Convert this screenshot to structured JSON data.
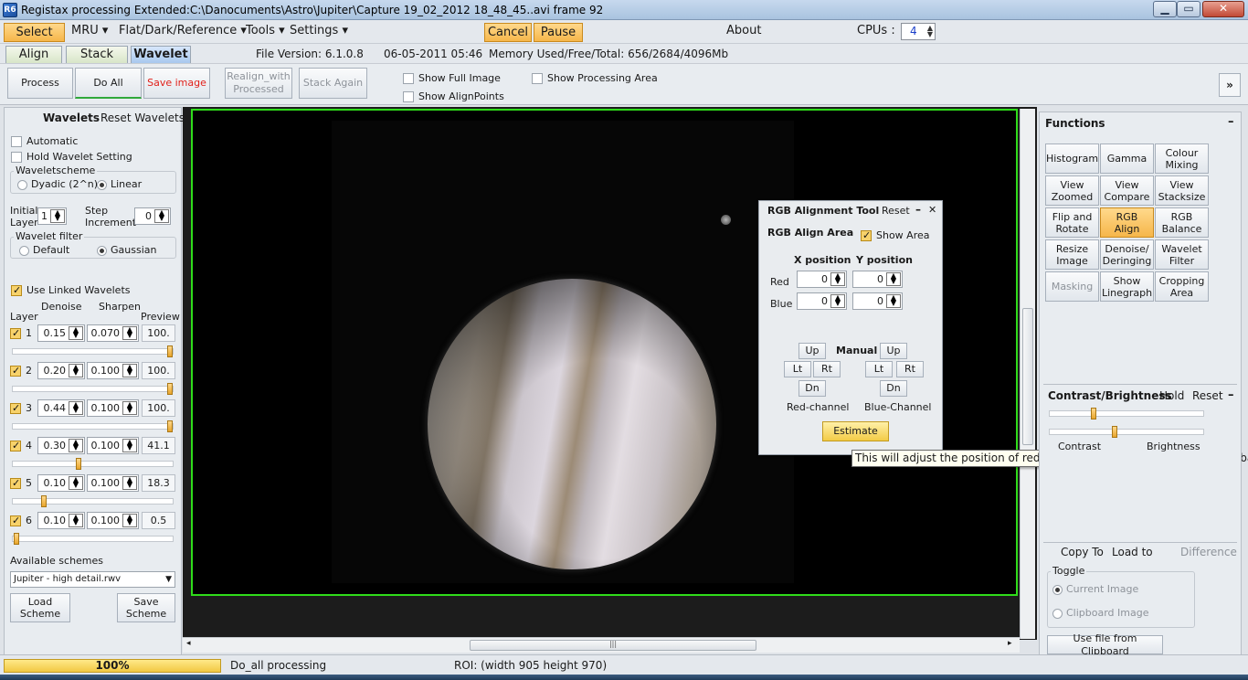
{
  "window": {
    "title": "Registax processing Extended:C:\\Danocuments\\Astro\\Jupiter\\Capture 19_02_2012 18_48_45..avi frame 92",
    "icon": "R6",
    "min_glyph": "▁",
    "max_glyph": "▭",
    "close_glyph": "✕"
  },
  "menu": {
    "select": "Select",
    "mru": "MRU ▾",
    "flat": "Flat/Dark/Reference ▾",
    "tools": "Tools ▾",
    "settings": "Settings ▾",
    "cancel": "Cancel",
    "pause": "Pause",
    "about": "About",
    "cpus_label": "CPUs :",
    "cpus_value": "4"
  },
  "tabs": {
    "align": "Align",
    "stack": "Stack",
    "wavelet": "Wavelet",
    "file_version": "File Version: 6.1.0.8",
    "date": "06-05-2011 05:46",
    "memory": "Memory Used/Free/Total: 656/2684/4096Mb"
  },
  "toolbar": {
    "process": "Process",
    "do_all": "Do All",
    "save_image": "Save image",
    "realign_line1": "Realign_with",
    "realign_line2": "Processed",
    "stack_again": "Stack Again",
    "show_full_image": "Show Full Image",
    "show_alignpoints": "Show AlignPoints",
    "show_processing_area": "Show Processing Area",
    "expand": "»"
  },
  "wavelets": {
    "title": "Wavelets",
    "reset": "Reset Wavelets",
    "automatic": "Automatic",
    "hold_setting": "Hold Wavelet Setting",
    "scheme_label": "Waveletscheme",
    "dyadic": "Dyadic (2^n)",
    "linear": "Linear",
    "initial_layer_l1": "Initial",
    "initial_layer_l2": "Layer",
    "initial_layer_value": "1",
    "step_l1": "Step",
    "step_l2": "Increment",
    "step_value": "0",
    "filter_label": "Wavelet filter",
    "default": "Default",
    "gaussian": "Gaussian",
    "use_linked": "Use Linked Wavelets",
    "col_denoise": "Denoise",
    "col_sharpen": "Sharpen",
    "col_layer": "Layer",
    "col_preview": "Preview",
    "layers": [
      {
        "num": "1",
        "denoise": "0.15",
        "sharpen": "0.070",
        "preview": "100.",
        "level": 1.0
      },
      {
        "num": "2",
        "denoise": "0.20",
        "sharpen": "0.100",
        "preview": "100.",
        "level": 1.0
      },
      {
        "num": "3",
        "denoise": "0.44",
        "sharpen": "0.100",
        "preview": "100.",
        "level": 1.0
      },
      {
        "num": "4",
        "denoise": "0.30",
        "sharpen": "0.100",
        "preview": "41.1",
        "level": 0.411
      },
      {
        "num": "5",
        "denoise": "0.10",
        "sharpen": "0.100",
        "preview": "18.3",
        "level": 0.183
      },
      {
        "num": "6",
        "denoise": "0.10",
        "sharpen": "0.100",
        "preview": "0.5",
        "level": 0.005
      }
    ],
    "available_schemes": "Available schemes",
    "scheme_value": "Jupiter - high detail.rwv",
    "load_l1": "Load",
    "load_l2": "Scheme",
    "save_l1": "Save",
    "save_l2": "Scheme"
  },
  "rgb_tool": {
    "title": "RGB Alignment Tool",
    "reset": "Reset",
    "minimize": "–",
    "close": "✕",
    "area": "RGB Align Area",
    "show_area": "Show Area",
    "x_position": "X position",
    "y_position": "Y position",
    "red": "Red",
    "blue": "Blue",
    "red_x": "0",
    "red_y": "0",
    "blue_x": "0",
    "blue_y": "0",
    "manual": "Manual",
    "up": "Up",
    "lt": "Lt",
    "rt": "Rt",
    "dn": "Dn",
    "red_channel": "Red-channel",
    "blue_channel": "Blue-Channel",
    "estimate": "Estimate",
    "tooltip": "This will adjust the position of red,green,blue layer for a better colour-balance"
  },
  "functions": {
    "title": "Functions",
    "collapse": "–",
    "buttons": [
      [
        "Histogram",
        ""
      ],
      [
        "Gamma",
        ""
      ],
      [
        "Colour",
        "Mixing"
      ],
      [
        "View",
        "Zoomed"
      ],
      [
        "View",
        "Compare"
      ],
      [
        "View",
        "Stacksize"
      ],
      [
        "Flip and",
        "Rotate"
      ],
      [
        "RGB",
        "Align"
      ],
      [
        "RGB",
        "Balance"
      ],
      [
        "Resize",
        "Image"
      ],
      [
        "Denoise/",
        "Deringing"
      ],
      [
        "Wavelet",
        "Filter"
      ],
      [
        "Masking",
        ""
      ],
      [
        "Show",
        "Linegraph"
      ],
      [
        "Cropping",
        "Area"
      ]
    ],
    "contrast_title": "Contrast/Brightness",
    "hold": "Hold",
    "reset": "Reset",
    "contrast": "Contrast",
    "brightness": "Brightness",
    "copy_to": "Copy To",
    "load_to": "Load to",
    "difference": "Difference",
    "toggle": "Toggle",
    "current_image": "Current Image",
    "clipboard_image": "Clipboard Image",
    "use_clipboard": "Use file from Clipboard"
  },
  "status": {
    "progress": "100%",
    "message": "Do_all processing",
    "roi": "ROI: (width 905 height 970)"
  },
  "colors": {
    "accent_orange": "#f6b64a",
    "frame_green": "#2fdc1a",
    "wavelet_tab": "#a8c8ee"
  }
}
